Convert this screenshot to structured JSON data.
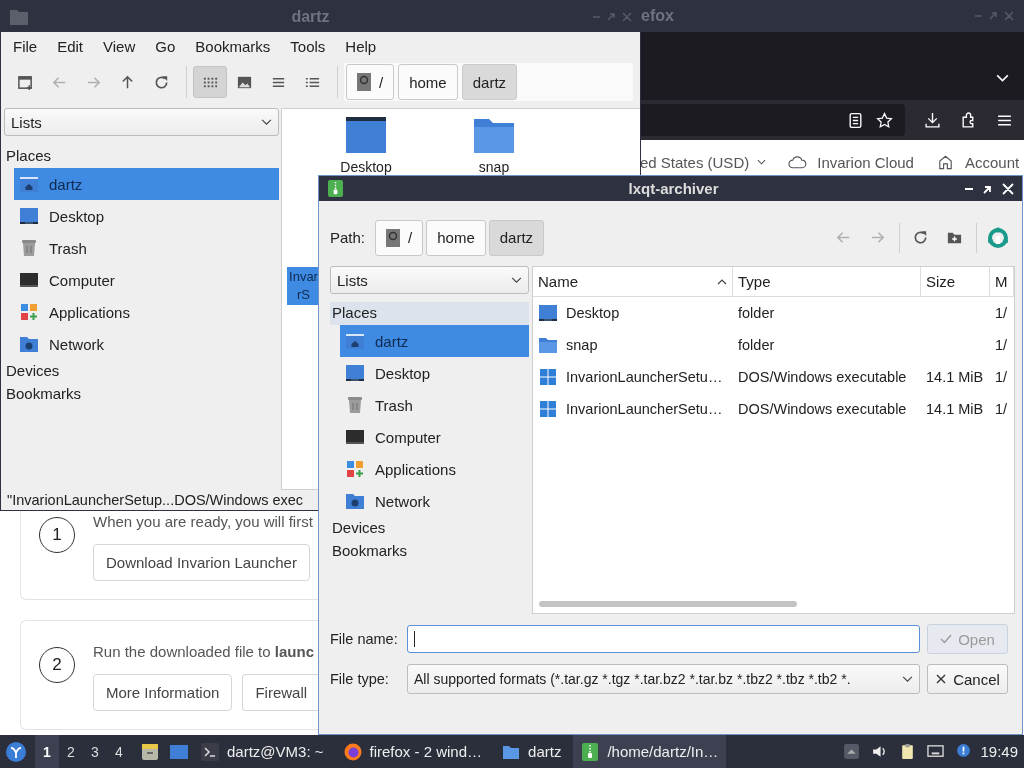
{
  "firefox_window": {
    "title": "efox",
    "page": {
      "currency": "ed States (USD)",
      "nav_links": [
        {
          "label": "Invarion Cloud",
          "kind": "cloud"
        },
        {
          "label": "Account",
          "kind": "home"
        }
      ],
      "steps": [
        {
          "number": "1",
          "text": "When you are ready, you will first",
          "buttons": [
            "Download Invarion Launcher"
          ]
        },
        {
          "number": "2",
          "text": "Run the downloaded file to **launc**",
          "buttons": [
            "More Information",
            "Firewall"
          ]
        }
      ]
    }
  },
  "file_manager": {
    "title": "dartz",
    "menu": [
      "File",
      "Edit",
      "View",
      "Go",
      "Bookmarks",
      "Tools",
      "Help"
    ],
    "nav_tools": [
      {
        "kind": "new-tab",
        "disabled": false
      },
      {
        "kind": "back",
        "disabled": true
      },
      {
        "kind": "forward",
        "disabled": true
      },
      {
        "kind": "up",
        "disabled": false
      },
      {
        "kind": "reload",
        "disabled": false
      }
    ],
    "view_modes": [
      {
        "kind": "icons",
        "selected": true
      },
      {
        "kind": "thumbnails",
        "selected": false
      },
      {
        "kind": "compact",
        "selected": false
      },
      {
        "kind": "details",
        "selected": false
      }
    ],
    "path": [
      {
        "label": "/",
        "kind": "root",
        "selected": false
      },
      {
        "label": "home",
        "kind": "dir",
        "selected": false
      },
      {
        "label": "dartz",
        "kind": "dir",
        "selected": true
      }
    ],
    "side_panel": {
      "view": "Lists",
      "sections": [
        {
          "label": "Places",
          "items": [
            {
              "label": "dartz",
              "kind": "home",
              "selected": true
            },
            {
              "label": "Desktop",
              "kind": "desktop",
              "selected": false
            },
            {
              "label": "Trash",
              "kind": "trash",
              "selected": false
            },
            {
              "label": "Computer",
              "kind": "computer",
              "selected": false
            },
            {
              "label": "Applications",
              "kind": "applications",
              "selected": false
            },
            {
              "label": "Network",
              "kind": "network",
              "selected": false
            }
          ]
        },
        {
          "label": "Devices"
        },
        {
          "label": "Bookmarks"
        }
      ]
    },
    "files": [
      {
        "label": "Desktop",
        "kind": "desktop",
        "selected": false
      },
      {
        "label": "snap",
        "kind": "folder",
        "selected": false
      },
      {
        "label": "Invar rS",
        "kind": "executable",
        "selected": true
      }
    ],
    "status": "\"InvarionLauncherSetup...DOS/Windows exec"
  },
  "archiver_dialog": {
    "title": "lxqt-archiver",
    "path_label": "Path:",
    "path": [
      {
        "label": "/",
        "kind": "root",
        "selected": false
      },
      {
        "label": "home",
        "kind": "dir",
        "selected": false
      },
      {
        "label": "dartz",
        "kind": "dir",
        "selected": true
      }
    ],
    "tools": [
      {
        "kind": "back",
        "disabled": true
      },
      {
        "kind": "forward",
        "disabled": true
      },
      {
        "kind": "reload",
        "disabled": false
      },
      {
        "kind": "new-folder",
        "disabled": false
      },
      {
        "kind": "app"
      }
    ],
    "side_panel": {
      "view": "Lists",
      "sections": [
        {
          "label": "Places",
          "items": [
            {
              "label": "dartz",
              "kind": "home",
              "selected": true
            },
            {
              "label": "Desktop",
              "kind": "desktop",
              "selected": false
            },
            {
              "label": "Trash",
              "kind": "trash",
              "selected": false
            },
            {
              "label": "Computer",
              "kind": "computer",
              "selected": false
            },
            {
              "label": "Applications",
              "kind": "applications",
              "selected": false
            },
            {
              "label": "Network",
              "kind": "network",
              "selected": false
            }
          ]
        },
        {
          "label": "Devices"
        },
        {
          "label": "Bookmarks"
        }
      ]
    },
    "columns": [
      {
        "label": "Name",
        "sorted": true
      },
      {
        "label": "Type",
        "sorted": false
      },
      {
        "label": "Size",
        "sorted": false
      },
      {
        "label": "M",
        "sorted": false
      }
    ],
    "rows": [
      {
        "name": "Desktop",
        "kind": "desktop",
        "type": "folder",
        "modified": "1/"
      },
      {
        "name": "snap",
        "kind": "folder",
        "type": "folder",
        "modified": "1/"
      },
      {
        "name": "InvarionLauncherSetu…",
        "kind": "executable",
        "type": "DOS/Windows executable",
        "size": "14.1 MiB",
        "modified": "1/"
      },
      {
        "name": "InvarionLauncherSetu…",
        "kind": "executable",
        "type": "DOS/Windows executable",
        "size": "14.1 MiB",
        "modified": "1/"
      }
    ],
    "file_name": {
      "label": "File name:",
      "focused": true
    },
    "file_type": {
      "label": "File type:",
      "value": "All supported formats (*.tar.gz *.tgz *.tar.bz2 *.tar.bz *.tbz2 *.tbz *.tb2 *."
    },
    "buttons": [
      {
        "label": "Open",
        "kind": "open",
        "disabled": true
      },
      {
        "label": "Cancel",
        "kind": "cancel",
        "disabled": false
      }
    ]
  },
  "taskbar": {
    "desktops": [
      {
        "label": "1",
        "selected": true
      },
      {
        "label": "2",
        "selected": false
      },
      {
        "label": "3",
        "selected": false
      },
      {
        "label": "4",
        "selected": false
      }
    ],
    "tasks": [
      {
        "label": "dartz@VM3: ~",
        "kind": "terminal",
        "selected": false
      },
      {
        "label": "firefox - 2 wind…",
        "kind": "browser",
        "selected": false
      },
      {
        "label": "dartz",
        "kind": "folder",
        "selected": false
      },
      {
        "label": "/home/dartz/In…",
        "kind": "archive",
        "selected": true
      }
    ],
    "clock": "19:49"
  }
}
